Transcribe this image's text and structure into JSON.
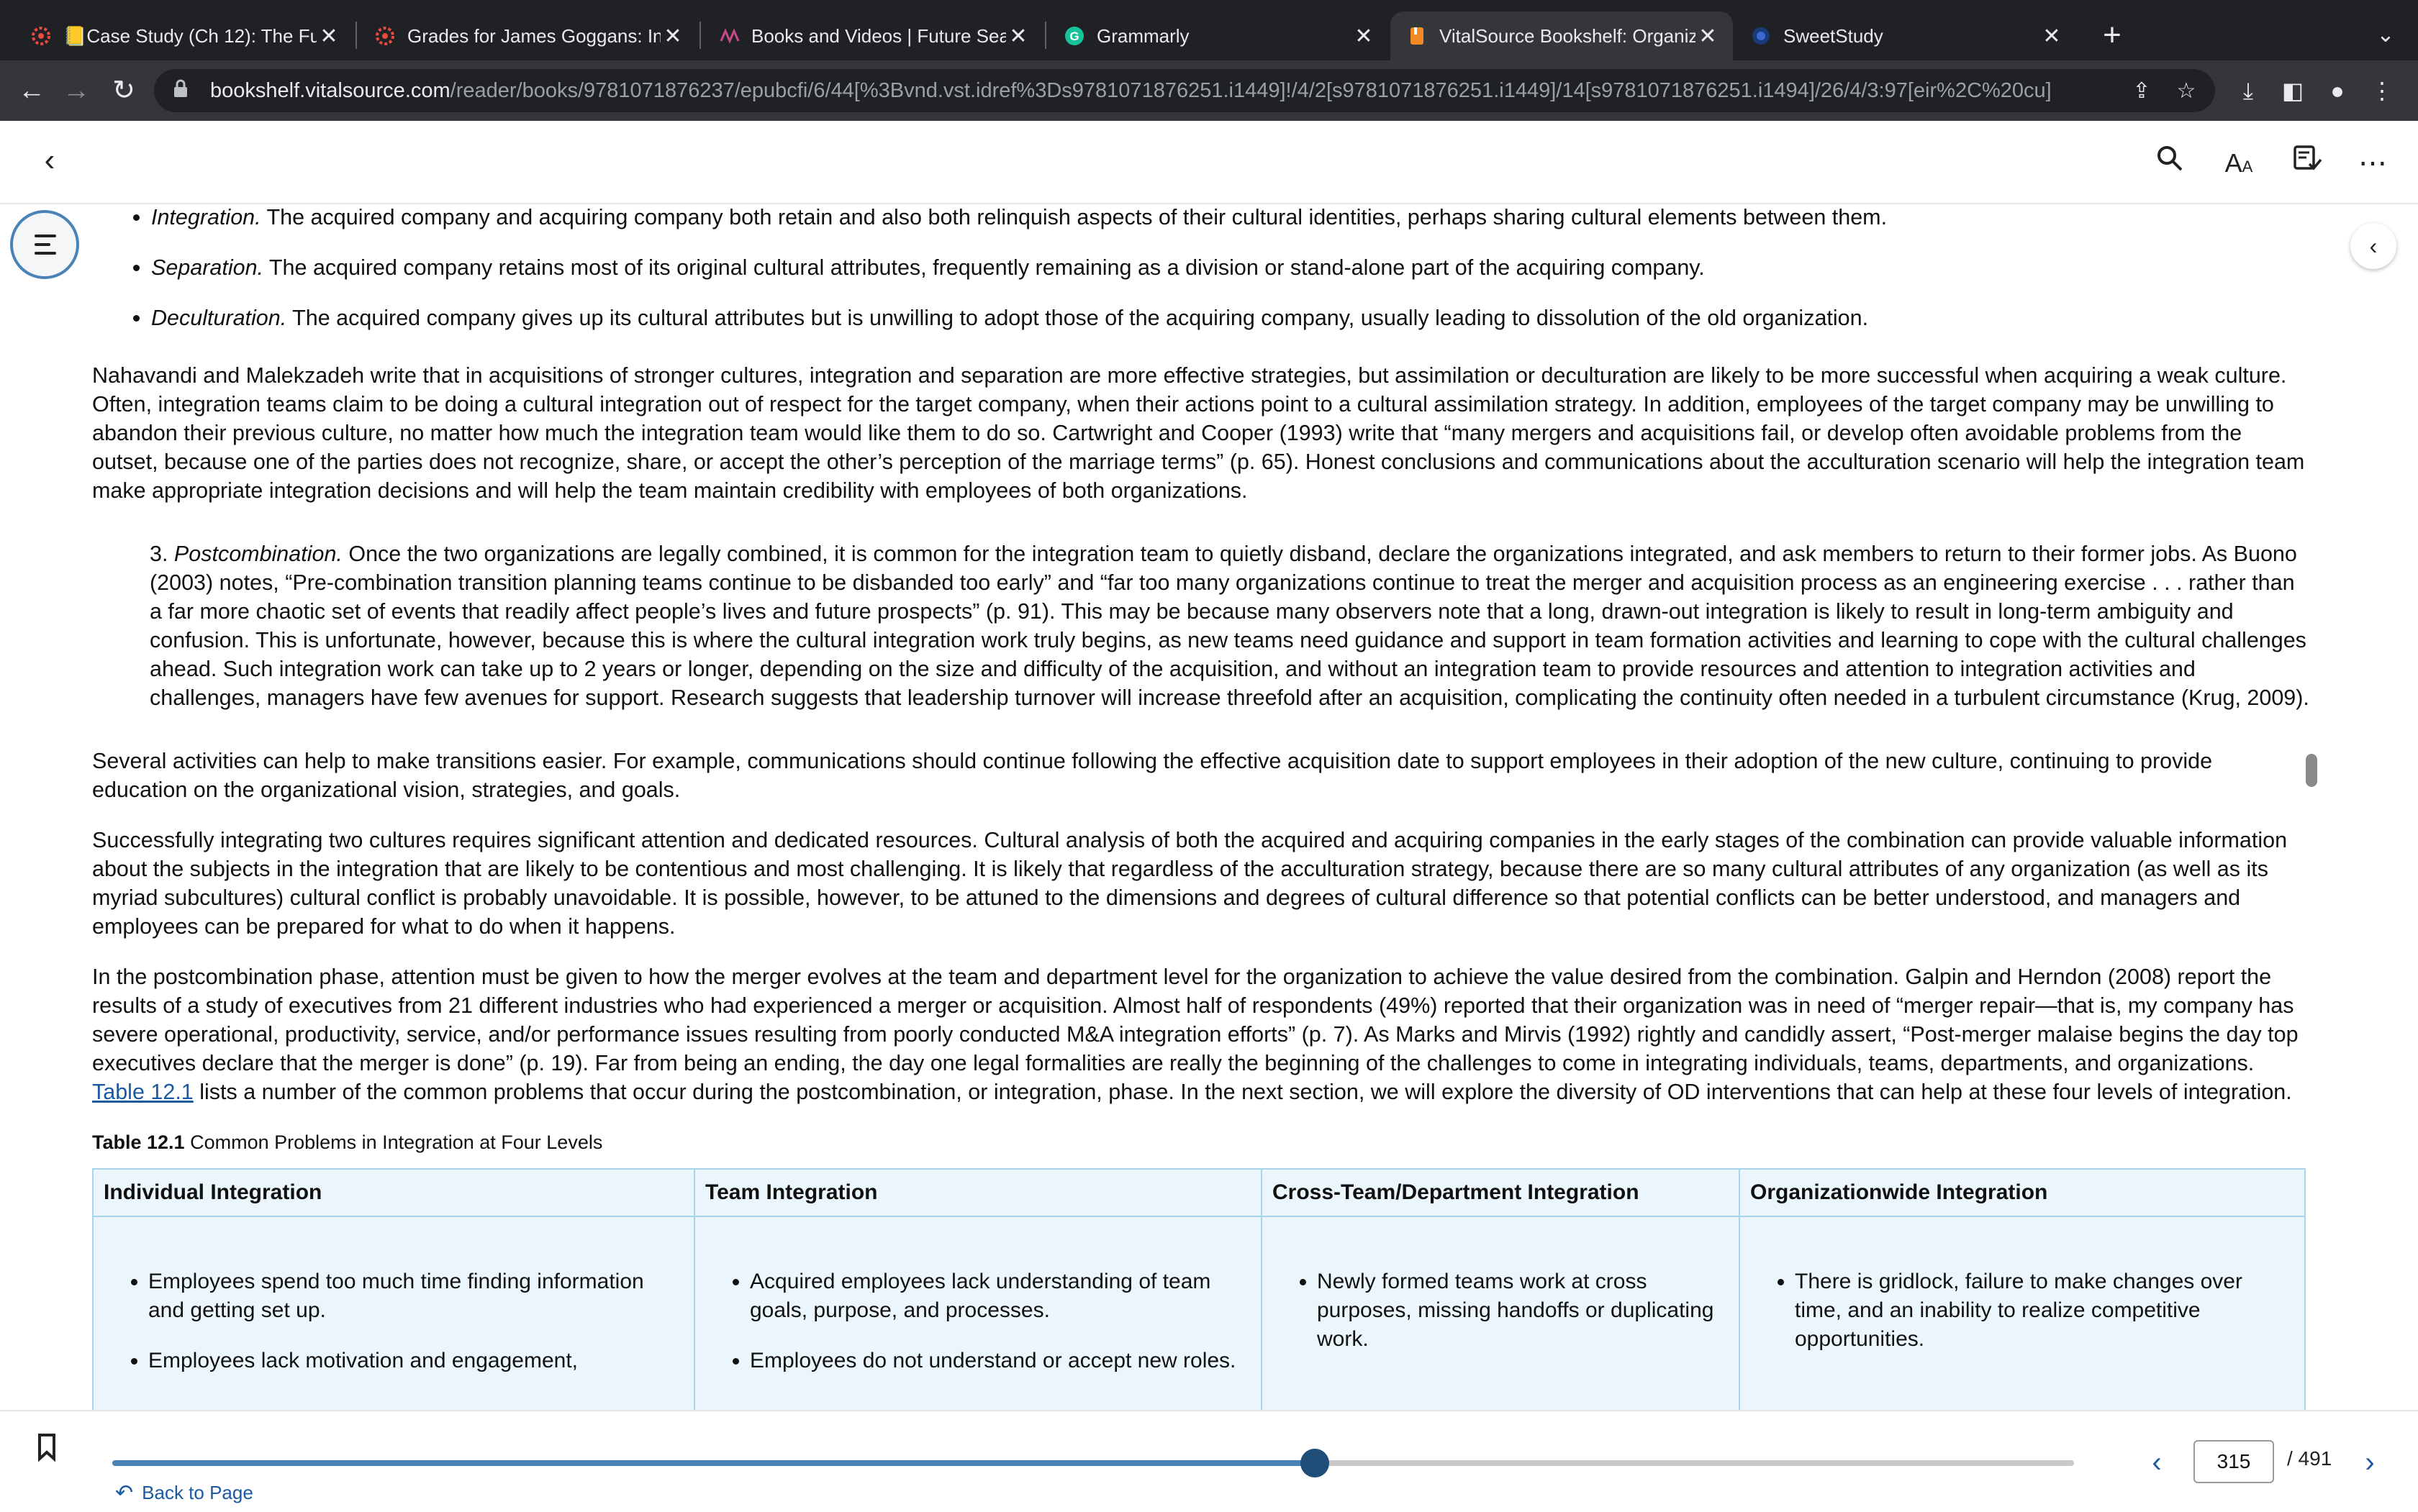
{
  "browser": {
    "tabs": [
      {
        "title": "📒Case Study (Ch 12): The Fut",
        "icon": "red-gear-icon"
      },
      {
        "title": "Grades for James Goggans: Int",
        "icon": "red-gear-icon"
      },
      {
        "title": "Books and Videos | Future Sea",
        "icon": "books-icon"
      },
      {
        "title": "Grammarly",
        "icon": "grammarly-icon"
      },
      {
        "title": "VitalSource Bookshelf: Organiz",
        "icon": "vitalsource-icon"
      },
      {
        "title": "SweetStudy",
        "icon": "sweetstudy-icon"
      }
    ],
    "url_host": "bookshelf.vitalsource.com",
    "url_path": "/reader/books/9781071876237/epubcfi/6/44[%3Bvnd.vst.idref%3Ds9781071876251.i1449]!/4/2[s9781071876251.i1449]/14[s9781071876251.i1494]/26/4/3:97[eir%2C%20cu]"
  },
  "content": {
    "bullets": [
      {
        "term": "Integration.",
        "text": " The acquired company and acquiring company both retain and also both relinquish aspects of their cultural identities, perhaps sharing cultural elements between them."
      },
      {
        "term": "Separation.",
        "text": " The acquired company retains most of its original cultural attributes, frequently remaining as a division or stand-alone part of the acquiring company."
      },
      {
        "term": "Deculturation.",
        "text": " The acquired company gives up its cultural attributes but is unwilling to adopt those of the acquiring company, usually leading to dissolution of the old organization."
      }
    ],
    "para1": "Nahavandi and Malekzadeh write that in acquisitions of stronger cultures, integration and separation are more effective strategies, but assimilation or deculturation are likely to be more successful when acquiring a weak culture. Often, integration teams claim to be doing a cultural integration out of respect for the target company, when their actions point to a cultural assimilation strategy. In addition, employees of the target company may be unwilling to abandon their previous culture, no matter how much the integration team would like them to do so. Cartwright and Cooper (1993) write that “many mergers and acquisitions fail, or develop often avoidable problems from the outset, because one of the parties does not recognize, share, or accept the other’s perception of the marriage terms” (p. 65). Honest conclusions and communications about the acculturation scenario will help the integration team make appropriate integration decisions and will help the team maintain credibility with employees of both organizations.",
    "postcomb_num": "3. ",
    "postcomb_term": "Postcombination.",
    "postcomb_text": " Once the two organizations are legally combined, it is common for the integration team to quietly disband, declare the organizations integrated, and ask members to return to their former jobs. As Buono (2003) notes, “Pre-combination transition planning teams continue to be disbanded too early” and “far too many organizations continue to treat the merger and acquisition process as an engineering exercise . . . rather than a far more chaotic set of events that readily affect people’s lives and future prospects” (p. 91). This may be because many observers note that a long, drawn-out integration is likely to result in long-term ambiguity and confusion. This is unfortunate, however, because this is where the cultural integration work truly begins, as new teams need guidance and support in team formation activities and learning to cope with the cultural challenges ahead. Such integration work can take up to 2 years or longer, depending on the size and difficulty of the acquisition, and without an integration team to provide resources and attention to integration activities and challenges, managers have few avenues for support. Research suggests that leadership turnover will increase threefold after an acquisition, complicating the continuity often needed in a turbulent circumstance (Krug, 2009).",
    "para2": "Several activities can help to make transitions easier. For example, communications should continue following the effective acquisition date to support employees in their adoption of the new culture, continuing to provide education on the organizational vision, strategies, and goals.",
    "para3": "Successfully integrating two cultures requires significant attention and dedicated resources. Cultural analysis of both the acquired and acquiring companies in the early stages of the combination can provide valuable information about the subjects in the integration that are likely to be contentious and most challenging. It is likely that regardless of the acculturation strategy, because there are so many cultural attributes of any organization (as well as its myriad subcultures) cultural conflict is probably unavoidable. It is possible, however, to be attuned to the dimensions and degrees of cultural difference so that potential conflicts can be better understood, and managers and employees can be prepared for what to do when it happens.",
    "para4_a": "In the postcombination phase, attention must be given to how the merger evolves at the team and department level for the organization to achieve the value desired from the combination. Galpin and Herndon (2008) report the results of a study of executives from 21 different industries who had experienced a merger or acquisition. Almost half of respondents (49%) reported that their organization was in need of “merger repair—that is, my company has severe operational, productivity, service, and/or performance issues resulting from poorly conducted M&A integration efforts” (p. 7). As Marks and Mirvis (1992) rightly and candidly assert, “Post-merger malaise begins the day top executives declare that the merger is done” (p. 19). Far from being an ending, the day one legal formalities are really the beginning of the challenges to come in integrating individuals, teams, departments, and organizations. ",
    "para4_link": "Table 12.1",
    "para4_b": " lists a number of the common problems that occur during the postcombination, or integration, phase. In the next section, we will explore the diversity of OD interventions that can help at these four levels of integration.",
    "table_label": "Table 12.1",
    "table_title": " Common Problems in Integration at Four Levels",
    "table": {
      "headers": [
        "Individual Integration",
        "Team Integration",
        "Cross-Team/Department Integration",
        "Organizationwide Integration"
      ],
      "col1": [
        "Employees spend too much time finding information and getting set up.",
        "Employees lack motivation and engagement,"
      ],
      "col2": [
        "Acquired employees lack understanding of team goals, purpose, and processes.",
        "Employees do not understand or accept new roles."
      ],
      "col3": [
        "Newly formed teams work at cross purposes, missing handoffs or duplicating work."
      ],
      "col4": [
        "There is gridlock, failure to make changes over time, and an inability to realize competitive opportunities."
      ]
    }
  },
  "footer": {
    "back_to_page": "Back to Page",
    "current_page": "315",
    "total_pages": "/ 491",
    "progress": 0.613
  }
}
